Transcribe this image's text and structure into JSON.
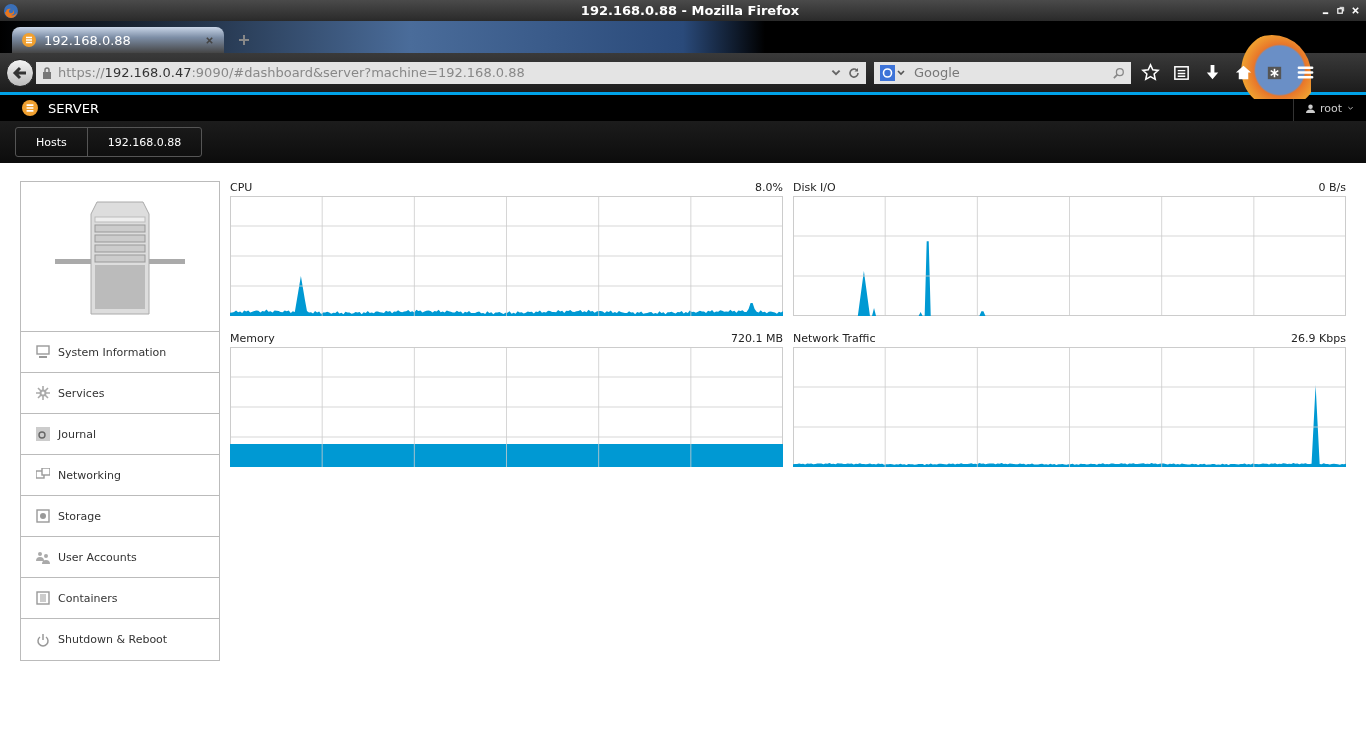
{
  "window": {
    "title": "192.168.0.88 - Mozilla Firefox"
  },
  "tabs": [
    {
      "label": "192.168.0.88",
      "selected": true
    }
  ],
  "address_bar": {
    "scheme": "https://",
    "host": "192.168.0.47",
    "rest": ":9090/#dashboard&server?machine=192.168.0.88"
  },
  "search": {
    "placeholder": "Google"
  },
  "app_header": {
    "title": "SERVER",
    "user": "root"
  },
  "breadcrumb": [
    "Hosts",
    "192.168.0.88"
  ],
  "sidebar": {
    "items": [
      {
        "label": "System Information"
      },
      {
        "label": "Services"
      },
      {
        "label": "Journal"
      },
      {
        "label": "Networking"
      },
      {
        "label": "Storage"
      },
      {
        "label": "User Accounts"
      },
      {
        "label": "Containers"
      },
      {
        "label": "Shutdown & Reboot"
      }
    ]
  },
  "graphs": [
    {
      "title": "CPU",
      "reading": "8.0%",
      "kind": "cpu"
    },
    {
      "title": "Disk I/O",
      "reading": "0 B/s",
      "kind": "disk"
    },
    {
      "title": "Memory",
      "reading": "720.1 MB",
      "kind": "memory"
    },
    {
      "title": "Network Traffic",
      "reading": "26.9 Kbps",
      "kind": "network"
    }
  ]
}
